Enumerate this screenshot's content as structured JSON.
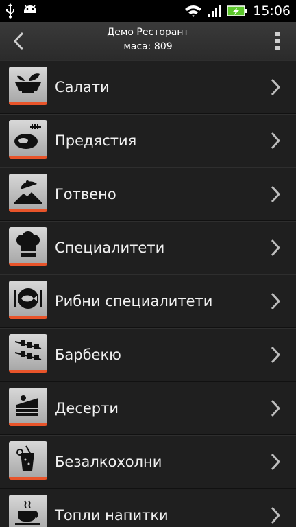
{
  "status_bar": {
    "time": "15:06",
    "icons": [
      "usb-icon",
      "android-icon",
      "wifi-icon",
      "signal-icon",
      "battery-charging-icon"
    ]
  },
  "header": {
    "restaurant_name": "Демо Ресторант",
    "table_label": "маса: 809",
    "back_icon": "back-chevron-icon",
    "menu_icon": "overflow-menu-icon"
  },
  "categories": [
    {
      "label": "Салати",
      "icon": "salad-bowl-icon"
    },
    {
      "label": "Предястия",
      "icon": "appetizer-plate-icon"
    },
    {
      "label": "Готвено",
      "icon": "cloche-dish-icon"
    },
    {
      "label": "Специалитети",
      "icon": "chef-hat-icon"
    },
    {
      "label": "Рибни специалитети",
      "icon": "fish-plate-icon"
    },
    {
      "label": "Барбекю",
      "icon": "skewers-icon"
    },
    {
      "label": "Десерти",
      "icon": "cake-slice-icon"
    },
    {
      "label": "Безалкохолни",
      "icon": "soft-drink-icon"
    },
    {
      "label": "Топли напитки",
      "icon": "coffee-cup-icon"
    }
  ],
  "colors": {
    "accent": "#e8542a",
    "background": "#1f1f1f"
  }
}
